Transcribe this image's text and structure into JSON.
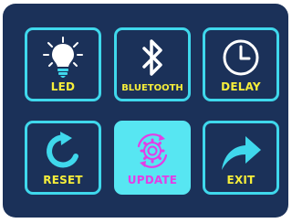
{
  "menu": {
    "items": [
      {
        "label": "LED",
        "icon": "lightbulb-icon",
        "selected": false
      },
      {
        "label": "BLUETOOTH",
        "icon": "bluetooth-icon",
        "selected": false
      },
      {
        "label": "DELAY",
        "icon": "clock-icon",
        "selected": false
      },
      {
        "label": "RESET",
        "icon": "reset-arrow-icon",
        "selected": false
      },
      {
        "label": "UPDATE",
        "icon": "gear-sync-icon",
        "selected": true
      },
      {
        "label": "EXIT",
        "icon": "exit-arrow-icon",
        "selected": false
      }
    ]
  },
  "colors": {
    "background": "#1b3159",
    "tile_border": "#3fd8ec",
    "label": "#f6ee3a",
    "selected_fill": "#57e6f2",
    "selected_label": "#e23ee6"
  }
}
